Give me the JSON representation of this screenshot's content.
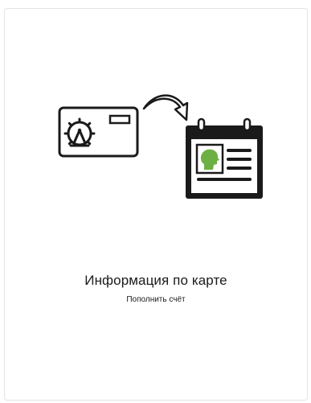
{
  "panel": {
    "title": "Информация по карте",
    "subtitle": "Пополнить счёт"
  },
  "illustration": {
    "icons": [
      "transport-card-icon",
      "curved-arrow-icon",
      "calendar-profile-icon"
    ],
    "accent_color": "#6cb043",
    "ink_color": "#1a1a1a"
  }
}
